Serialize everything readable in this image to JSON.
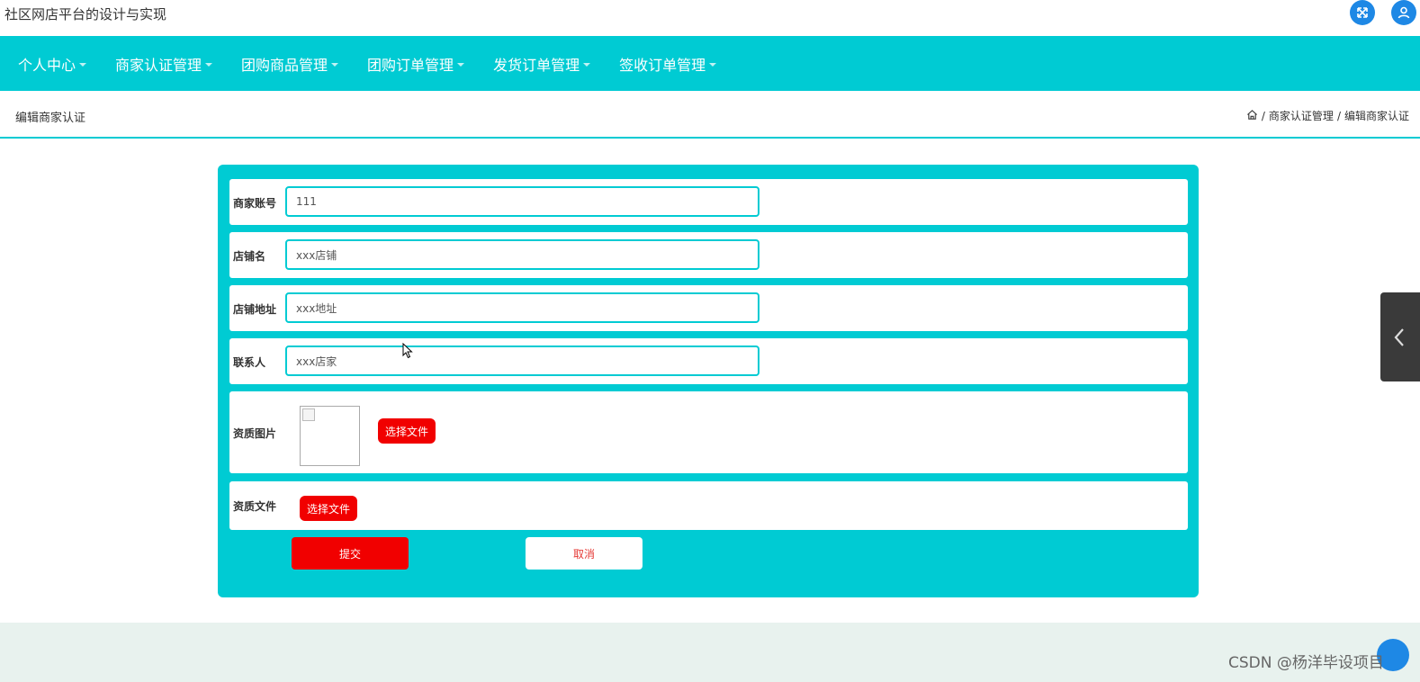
{
  "app": {
    "title": "社区网店平台的设计与实现"
  },
  "header_icons": {
    "fullscreen": "fullscreen-icon",
    "user": "user-icon"
  },
  "nav": {
    "items": [
      {
        "label": "个人中心"
      },
      {
        "label": "商家认证管理"
      },
      {
        "label": "团购商品管理"
      },
      {
        "label": "团购订单管理"
      },
      {
        "label": "发货订单管理"
      },
      {
        "label": "签收订单管理"
      }
    ]
  },
  "page": {
    "title": "编辑商家认证",
    "breadcrumb": [
      "商家认证管理",
      "编辑商家认证"
    ],
    "breadcrumb_sep": "/"
  },
  "form": {
    "fields": [
      {
        "label": "商家账号",
        "value": "111"
      },
      {
        "label": "店铺名",
        "value": "xxx店铺"
      },
      {
        "label": "店铺地址",
        "value": "xxx地址"
      },
      {
        "label": "联系人",
        "value": "xxx店家"
      }
    ],
    "image": {
      "label": "资质图片",
      "button": "选择文件"
    },
    "file": {
      "label": "资质文件",
      "button": "选择文件"
    },
    "submit_label": "提交",
    "cancel_label": "取消"
  },
  "watermark": "CSDN @杨洋毕设项目",
  "colors": {
    "primary": "#00cbd3",
    "danger": "#f10000",
    "icon_blue": "#1e88e5",
    "footer_bg": "#e8f2ee"
  }
}
